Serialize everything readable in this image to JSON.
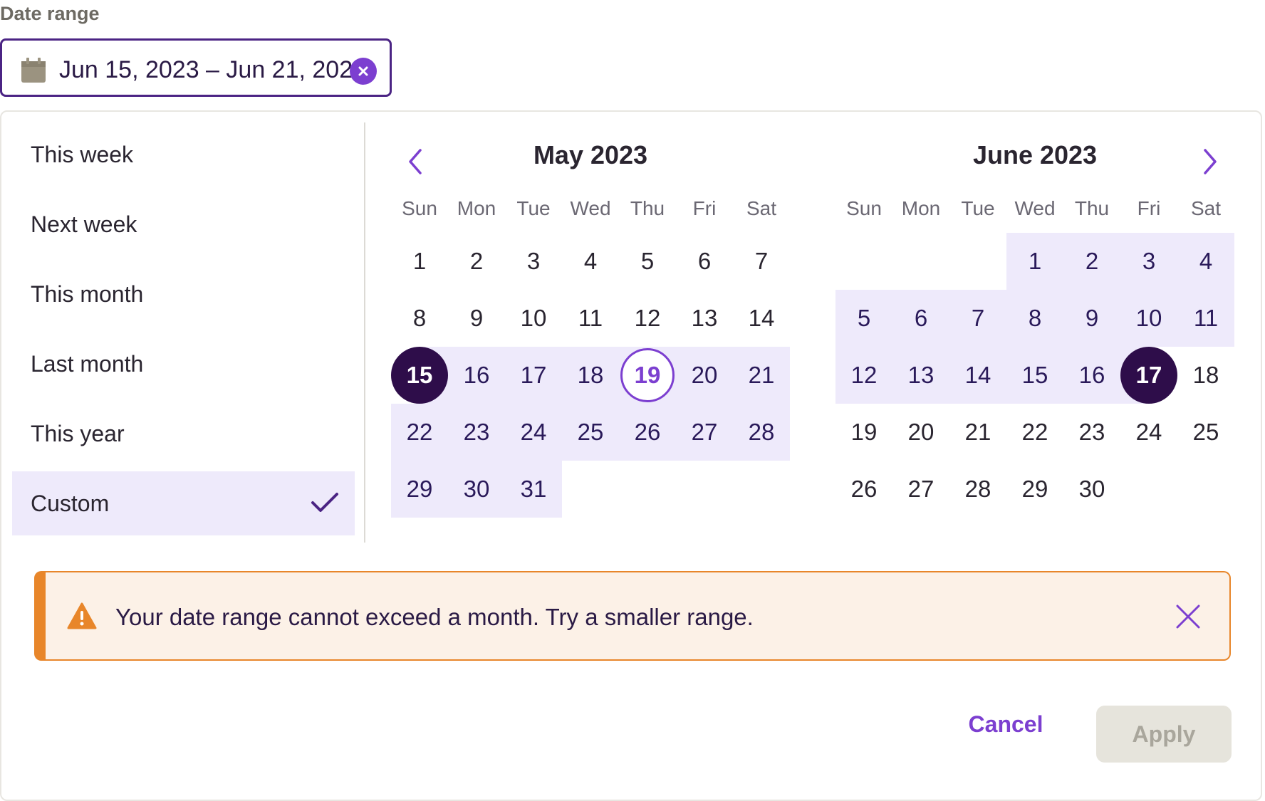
{
  "label": "Date range",
  "field": {
    "value": "Jun 15, 2023 – Jun 21, 2023",
    "icon": "calendar-icon",
    "clear_icon": "clear-icon"
  },
  "presets": [
    {
      "label": "This week",
      "selected": false
    },
    {
      "label": "Next week",
      "selected": false
    },
    {
      "label": "This month",
      "selected": false
    },
    {
      "label": "Last month",
      "selected": false
    },
    {
      "label": "This year",
      "selected": false
    },
    {
      "label": "Custom",
      "selected": true
    }
  ],
  "weekdays": [
    "Sun",
    "Mon",
    "Tue",
    "Wed",
    "Thu",
    "Fri",
    "Sat"
  ],
  "months": [
    {
      "title": "May 2023",
      "weeks": [
        [
          {
            "d": "1"
          },
          {
            "d": "2"
          },
          {
            "d": "3"
          },
          {
            "d": "4"
          },
          {
            "d": "5"
          },
          {
            "d": "6"
          },
          {
            "d": "7"
          }
        ],
        [
          {
            "d": "8"
          },
          {
            "d": "9"
          },
          {
            "d": "10"
          },
          {
            "d": "11"
          },
          {
            "d": "12"
          },
          {
            "d": "13"
          },
          {
            "d": "14"
          }
        ],
        [
          {
            "d": "15",
            "state": "selected"
          },
          {
            "d": "16",
            "state": "range"
          },
          {
            "d": "17",
            "state": "range"
          },
          {
            "d": "18",
            "state": "range"
          },
          {
            "d": "19",
            "state": "today"
          },
          {
            "d": "20",
            "state": "range"
          },
          {
            "d": "21",
            "state": "range"
          }
        ],
        [
          {
            "d": "22",
            "state": "range"
          },
          {
            "d": "23",
            "state": "range"
          },
          {
            "d": "24",
            "state": "range"
          },
          {
            "d": "25",
            "state": "range"
          },
          {
            "d": "26",
            "state": "range"
          },
          {
            "d": "27",
            "state": "range"
          },
          {
            "d": "28",
            "state": "range"
          }
        ],
        [
          {
            "d": "29",
            "state": "range"
          },
          {
            "d": "30",
            "state": "range"
          },
          {
            "d": "31",
            "state": "range"
          },
          {
            "d": ""
          },
          {
            "d": ""
          },
          {
            "d": ""
          },
          {
            "d": ""
          }
        ]
      ]
    },
    {
      "title": "June 2023",
      "weeks": [
        [
          {
            "d": ""
          },
          {
            "d": ""
          },
          {
            "d": ""
          },
          {
            "d": "1",
            "state": "range"
          },
          {
            "d": "2",
            "state": "range"
          },
          {
            "d": "3",
            "state": "range"
          },
          {
            "d": "4",
            "state": "range"
          }
        ],
        [
          {
            "d": "5",
            "state": "range"
          },
          {
            "d": "6",
            "state": "range"
          },
          {
            "d": "7",
            "state": "range"
          },
          {
            "d": "8",
            "state": "range"
          },
          {
            "d": "9",
            "state": "range"
          },
          {
            "d": "10",
            "state": "range"
          },
          {
            "d": "11",
            "state": "range"
          }
        ],
        [
          {
            "d": "12",
            "state": "range"
          },
          {
            "d": "13",
            "state": "range"
          },
          {
            "d": "14",
            "state": "range"
          },
          {
            "d": "15",
            "state": "range"
          },
          {
            "d": "16",
            "state": "range"
          },
          {
            "d": "17",
            "state": "selected"
          },
          {
            "d": "18"
          }
        ],
        [
          {
            "d": "19"
          },
          {
            "d": "20"
          },
          {
            "d": "21"
          },
          {
            "d": "22"
          },
          {
            "d": "23"
          },
          {
            "d": "24"
          },
          {
            "d": "25"
          }
        ],
        [
          {
            "d": "26"
          },
          {
            "d": "27"
          },
          {
            "d": "28"
          },
          {
            "d": "29"
          },
          {
            "d": "30"
          },
          {
            "d": ""
          },
          {
            "d": ""
          }
        ]
      ]
    }
  ],
  "alert": {
    "message": "Your date range cannot exceed a month. Try a smaller range.",
    "icon": "warning-icon"
  },
  "actions": {
    "cancel": "Cancel",
    "apply": "Apply"
  },
  "colors": {
    "accent": "#7c3fd0",
    "selected": "#2e0d4a",
    "range": "#eeeafb",
    "warning": "#e8862a"
  }
}
